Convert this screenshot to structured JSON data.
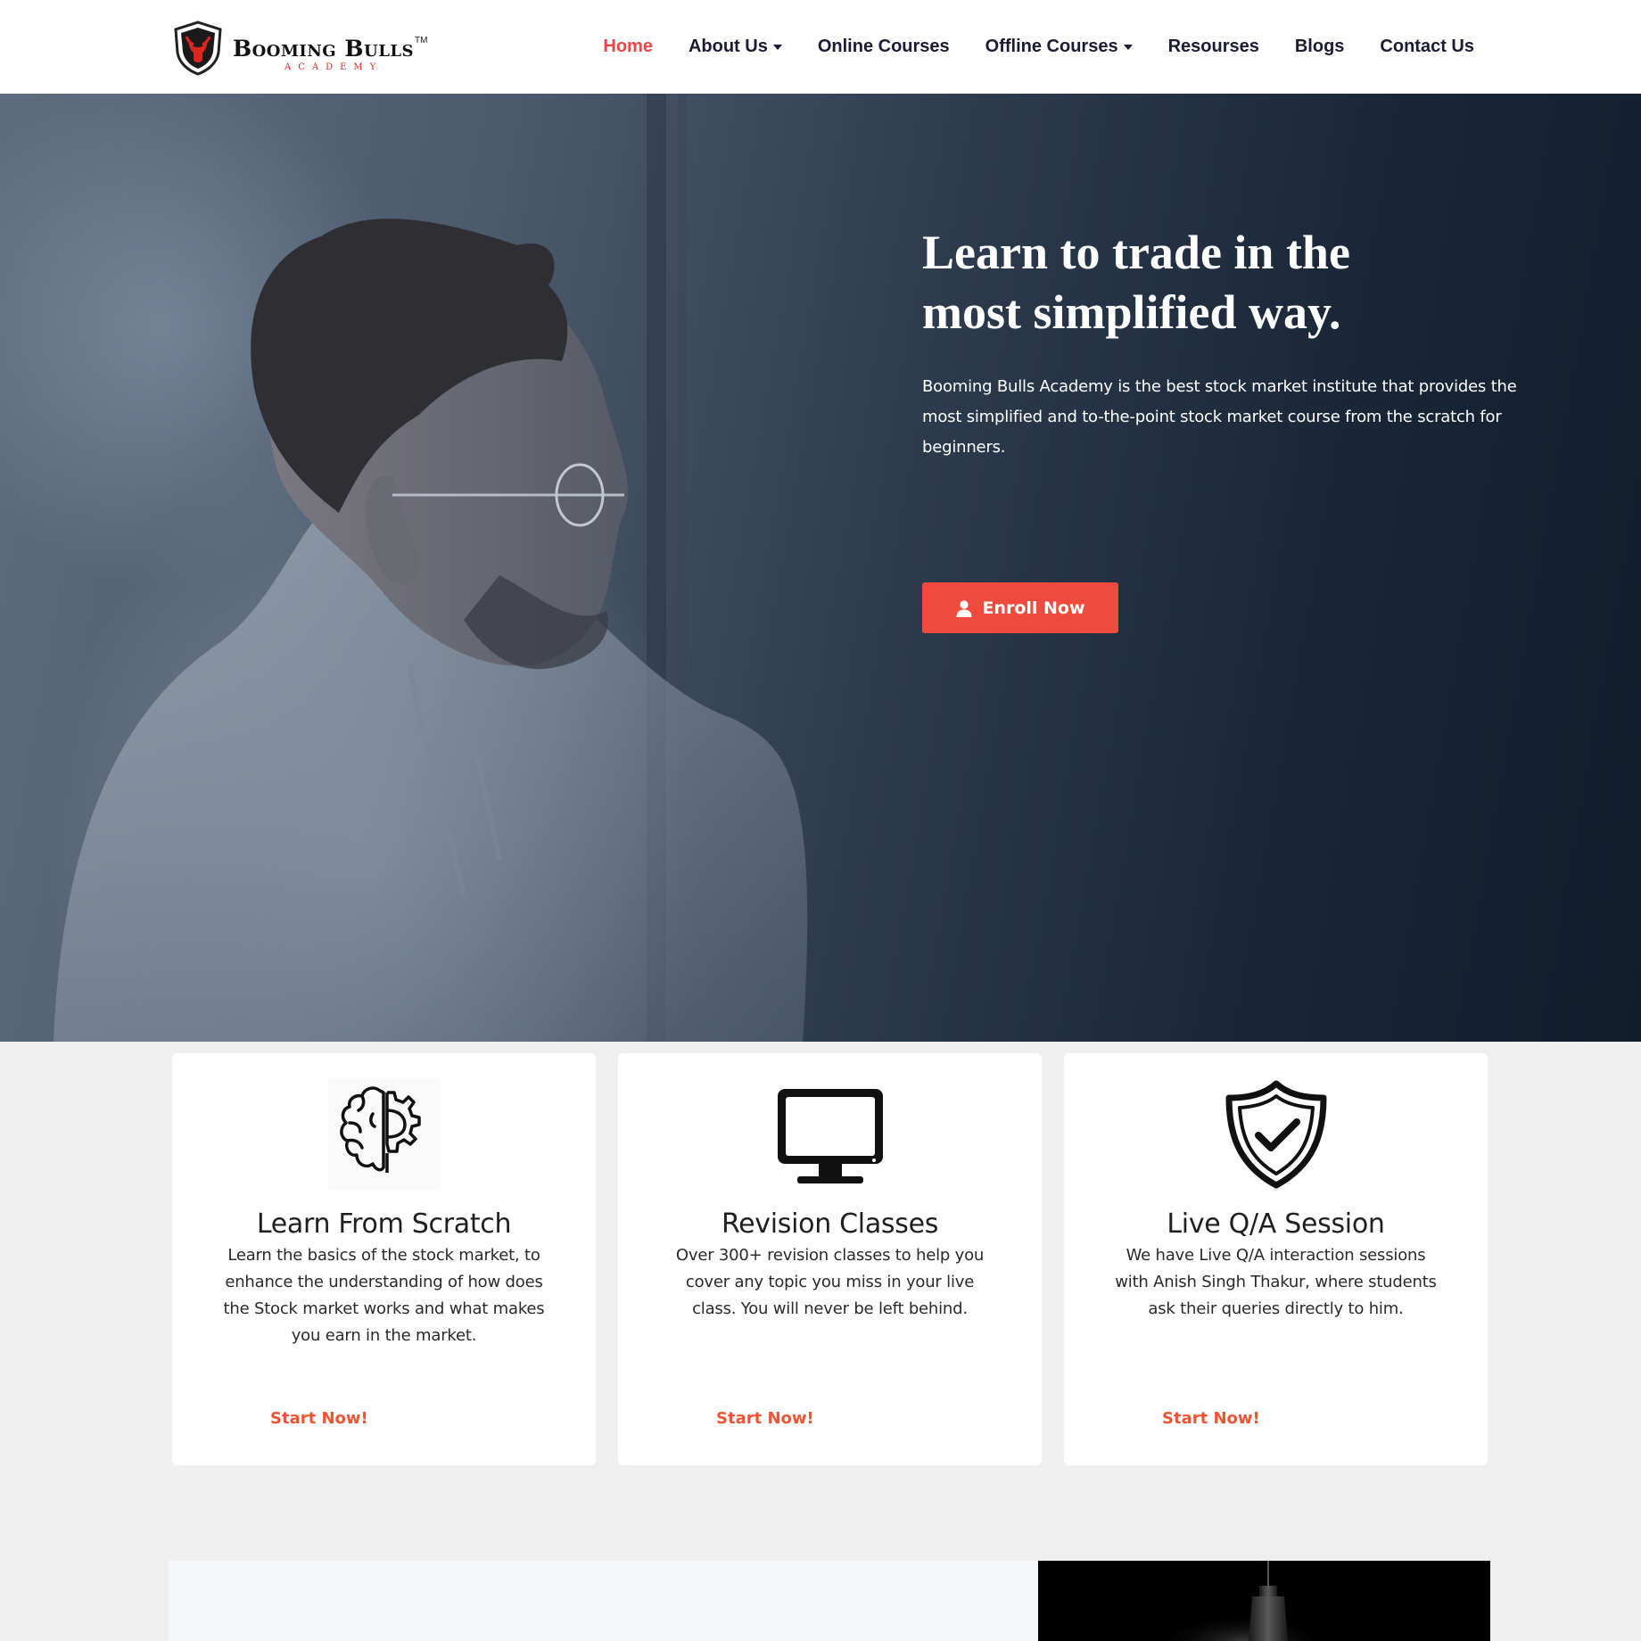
{
  "brand": {
    "name": "Booming Bulls",
    "trademark": "TM",
    "subtitle": "ACADEMY",
    "accent": "#ee4444",
    "button_color": "#ee4b3e",
    "link_color": "#ef5435"
  },
  "nav": {
    "items": [
      {
        "label": "Home",
        "active": true
      },
      {
        "label": "About Us",
        "dropdown": true
      },
      {
        "label": "Online Courses"
      },
      {
        "label": "Offline Courses",
        "dropdown": true
      },
      {
        "label": "Resourses"
      },
      {
        "label": "Blogs"
      },
      {
        "label": "Contact Us"
      }
    ]
  },
  "hero": {
    "title_line1": "Learn to trade in the",
    "title_line2": "most simplified way.",
    "description": "Booming Bulls Academy is the best stock market institute that provides the most simplified and to-the-point stock market course from the scratch for beginners.",
    "cta_label": "Enroll Now",
    "cta_icon": "user-icon"
  },
  "features": [
    {
      "icon": "brain-gear-icon",
      "title": "Learn From Scratch",
      "text": "Learn the basics of the stock market, to enhance the understanding of how does the Stock market works and what makes you earn in the market.",
      "link": "Start Now!"
    },
    {
      "icon": "monitor-icon",
      "title": "Revision Classes",
      "text": "Over 300+ revision classes to help you cover any topic you miss in your live class. You will never be left behind.",
      "link": "Start Now!"
    },
    {
      "icon": "shield-check-icon",
      "title": "Live Q/A Session",
      "text": "We have Live Q/A interaction sessions with Anish Singh Thakur, where students ask their queries directly to him.",
      "link": "Start Now!"
    }
  ]
}
